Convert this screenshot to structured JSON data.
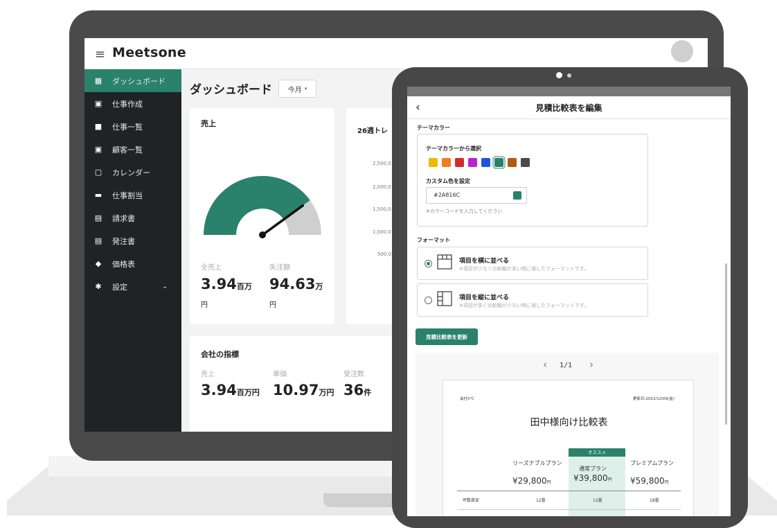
{
  "laptop": {
    "app_name": "Meetsone",
    "sidebar": {
      "items": [
        {
          "label": "ダッシュボード",
          "icon": "dashboard-icon"
        },
        {
          "label": "仕事作成",
          "icon": "briefcase-plus-icon"
        },
        {
          "label": "仕事一覧",
          "icon": "briefcase-icon"
        },
        {
          "label": "顧客一覧",
          "icon": "contact-card-icon"
        },
        {
          "label": "カレンダー",
          "icon": "calendar-icon"
        },
        {
          "label": "仕事割当",
          "icon": "truck-icon"
        },
        {
          "label": "請求書",
          "icon": "receipt-icon"
        },
        {
          "label": "発注書",
          "icon": "document-list-icon"
        },
        {
          "label": "価格表",
          "icon": "tag-icon"
        },
        {
          "label": "設定",
          "icon": "gear-icon"
        }
      ]
    },
    "page_title": "ダッシュボード",
    "period_select": "今月",
    "sales_card": {
      "title": "売上",
      "gauge_fraction": 0.8,
      "total_sales_label": "全売上",
      "total_sales_value": "3.94",
      "total_sales_unit": "百万",
      "total_sales_yen": "円",
      "lost_label": "失注額",
      "lost_value": "94.63",
      "lost_unit": "万",
      "lost_yen": "円"
    },
    "trend_card": {
      "title": "26週トレ",
      "y_ticks": [
        "2,500,0",
        "2,000,0",
        "1,500,0",
        "1,000,0",
        "500,0"
      ]
    },
    "kpi_card": {
      "title": "会社の指標",
      "items": [
        {
          "label": "売上",
          "value": "3.94",
          "unit": "百万円"
        },
        {
          "label": "単価",
          "value": "10.97",
          "unit": "万円"
        },
        {
          "label": "受注数",
          "value": "36",
          "unit": "件"
        }
      ]
    }
  },
  "tablet": {
    "back_icon": "chevron-left-icon",
    "modal_title": "見積比較表を編集",
    "theme": {
      "section_title": "テーマカラー",
      "preset_label": "テーマカラーから選択",
      "swatches": [
        "#F2B705",
        "#F07F1E",
        "#D52B2B",
        "#B428C9",
        "#1C56D8",
        "#2A816C",
        "#B35A12",
        "#4A4A4A"
      ],
      "selected_index": 5,
      "custom_label": "カスタム色を設定",
      "custom_value": "#2A816C",
      "custom_hint": "※カラーコードを入力してください"
    },
    "format": {
      "section_title": "フォーマット",
      "options": [
        {
          "title": "項目を横に並べる",
          "hint": "※項目が少なく比較軸が多い時に適したフォーマットです。",
          "selected": true
        },
        {
          "title": "項目を縦に並べる",
          "hint": "※項目が多く比較軸が少ない時に適したフォーマットです。",
          "selected": false
        }
      ]
    },
    "update_button": "見積比較表を更新",
    "pager": {
      "prev": "‹",
      "page": "1/1",
      "next": "›"
    },
    "document": {
      "company": "会社5℃",
      "date": "更新日:2022/12/09(金)",
      "title": "田中様向け比較表",
      "recommend_badge": "オススメ",
      "plans": [
        {
          "name": "リーズナブルプラン",
          "price": "¥29,800",
          "yen": "円"
        },
        {
          "name": "通常プラン",
          "price": "¥39,800",
          "yen": "円"
        },
        {
          "name": "プレミアムプラン",
          "price": "¥59,800",
          "yen": "円"
        }
      ],
      "row_label": "坪数目安",
      "row_values": [
        "12畳",
        "12畳",
        "18畳"
      ]
    }
  }
}
